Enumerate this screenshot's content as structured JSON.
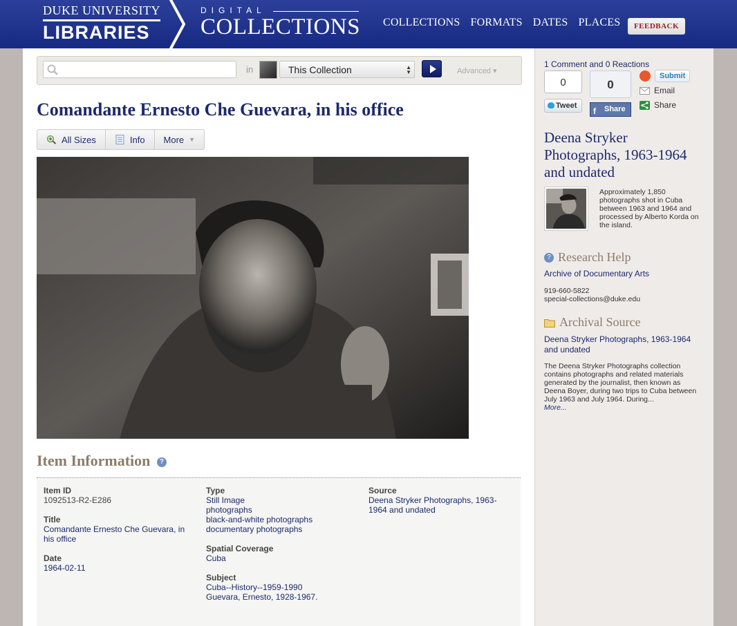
{
  "header": {
    "logo_line1": "DUKE UNIVERSITY",
    "logo_line2": "LIBRARIES",
    "dc_line1": "DIGITAL",
    "dc_line2": "COLLECTIONS",
    "nav": [
      "COLLECTIONS",
      "FORMATS",
      "DATES",
      "PLACES"
    ],
    "feedback_label": "FEEDBACK"
  },
  "search": {
    "query": "",
    "in_label": "in",
    "scope_value": "This Collection",
    "advanced_label": "Advanced"
  },
  "item": {
    "title": "Comandante Ernesto Che Guevara, in his office",
    "tabs": [
      "All Sizes",
      "Info",
      "More"
    ]
  },
  "info": {
    "heading": "Item Information",
    "col1": [
      {
        "label": "Item ID",
        "values": [
          "1092513-R2-E286"
        ],
        "plain": true
      },
      {
        "label": "Title",
        "values": [
          "Comandante Ernesto Che Guevara, in his office"
        ]
      },
      {
        "label": "Date",
        "values": [
          "1964-02-11"
        ]
      }
    ],
    "col2": [
      {
        "label": "Type",
        "values": [
          "Still Image",
          "photographs",
          "black-and-white photographs",
          "documentary photographs"
        ]
      },
      {
        "label": "Spatial Coverage",
        "values": [
          "Cuba"
        ]
      },
      {
        "label": "Subject",
        "values": [
          "Cuba--History--1959-1990",
          "Guevara, Ernesto, 1928-1967."
        ]
      }
    ],
    "col3": [
      {
        "label": "Source",
        "values": [
          "Deena Stryker Photographs, 1963-1964 and undated"
        ]
      }
    ]
  },
  "sidebar": {
    "comments_link": "1 Comment and 0 Reactions",
    "tweet_count": "0",
    "tweet_label": "Tweet",
    "share_count": "0",
    "share_label": "Share",
    "submit_label": "Submit",
    "email_label": "Email",
    "share2_label": "Share",
    "collection_title": "Deena Stryker Photographs, 1963-1964 and undated",
    "collection_desc": "Approximately 1,850 photographs shot in Cuba between 1963 and 1964 and processed by Alberto Korda on the island.",
    "research_heading": "Research Help",
    "research_link": "Archive of Documentary Arts",
    "phone": "919-660-5822",
    "email": "special-collections@duke.edu",
    "archival_heading": "Archival Source",
    "archival_link": "Deena Stryker Photographs, 1963-1964 and undated",
    "archival_desc": "The Deena Stryker Photographs collection contains photographs and related materials generated by the journalist, then known as Deena Boyer, during two trips to Cuba between July 1963 and July 1964. During...",
    "more_label": "More..."
  },
  "colors": {
    "header_blue": "#1f3290",
    "link_blue": "#1c2a6b",
    "heading_brown": "#8d7b69"
  }
}
